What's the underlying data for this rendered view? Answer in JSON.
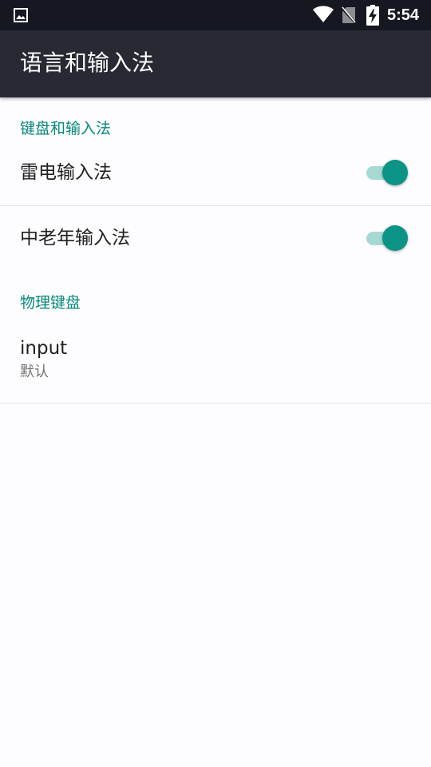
{
  "status_bar": {
    "time": "5:54",
    "icons": [
      "image-icon",
      "wifi-icon",
      "no-sim-icon",
      "battery-charging-icon"
    ]
  },
  "app_bar": {
    "title": "语言和输入法"
  },
  "sections": [
    {
      "header": "键盘和输入法",
      "items": [
        {
          "label": "雷电输入法",
          "toggle_on": true
        },
        {
          "label": "中老年输入法",
          "toggle_on": true
        }
      ]
    },
    {
      "header": "物理键盘",
      "items": [
        {
          "label": "input",
          "summary": "默认"
        }
      ]
    }
  ],
  "colors": {
    "accent": "#08897a",
    "switch_thumb": "#0b9485",
    "switch_track": "#a6d9d4",
    "app_bar": "#272a33",
    "status_bar": "#151820",
    "background": "#fdfcff"
  }
}
